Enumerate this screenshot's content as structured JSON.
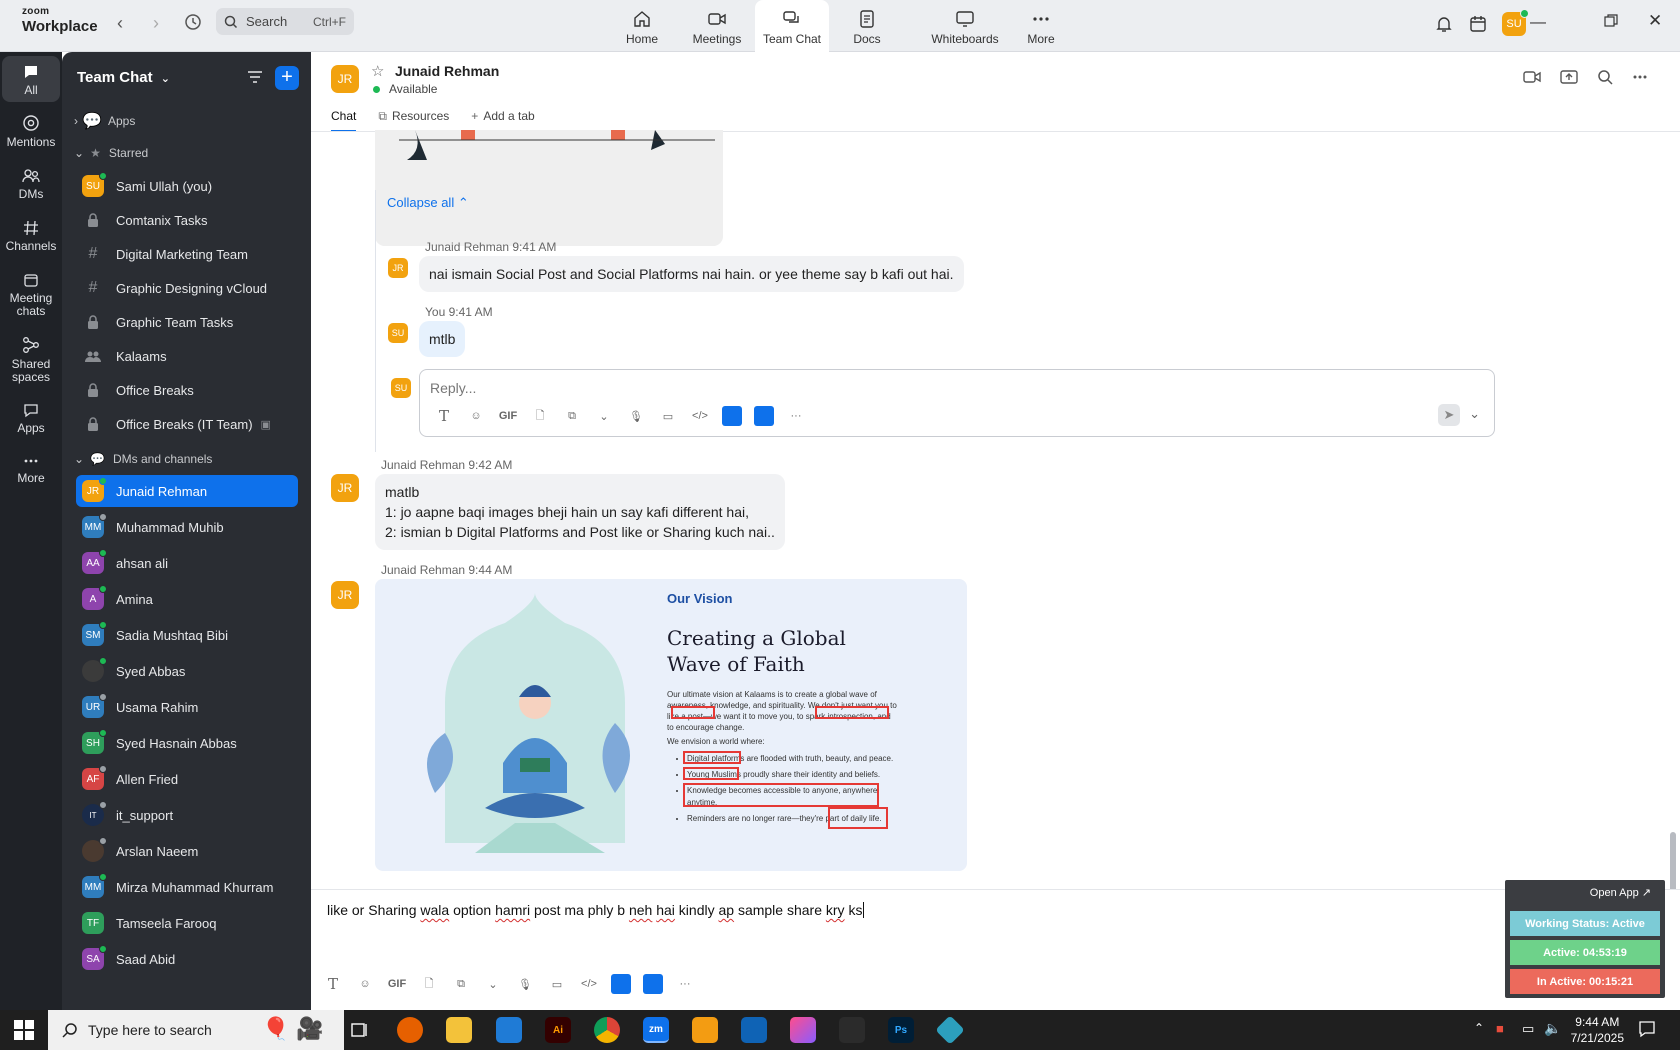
{
  "brand": {
    "line1": "zoom",
    "line2": "Workplace"
  },
  "search": {
    "label": "Search",
    "shortcut": "Ctrl+F"
  },
  "nav_tabs": [
    {
      "label": "Home"
    },
    {
      "label": "Meetings"
    },
    {
      "label": "Team Chat"
    },
    {
      "label": "Docs"
    },
    {
      "label": "Whiteboards"
    },
    {
      "label": "More"
    }
  ],
  "user": {
    "initials": "SU"
  },
  "rail": [
    {
      "label": "All"
    },
    {
      "label": "Mentions"
    },
    {
      "label": "DMs"
    },
    {
      "label": "Channels"
    },
    {
      "label": "Meeting chats"
    },
    {
      "label": "Shared spaces"
    },
    {
      "label": "Apps"
    },
    {
      "label": "More"
    }
  ],
  "sidebar": {
    "title": "Team Chat",
    "sections": {
      "apps": "Apps",
      "starred": "Starred",
      "dms": "DMs and channels"
    },
    "starred": [
      {
        "label": "Sami Ullah (you)",
        "initials": "SU"
      },
      {
        "label": "Comtanix Tasks"
      },
      {
        "label": "Digital Marketing Team"
      },
      {
        "label": "Graphic Designing vCloud"
      },
      {
        "label": "Graphic Team Tasks"
      },
      {
        "label": "Kalaams"
      },
      {
        "label": "Office Breaks"
      },
      {
        "label": "Office Breaks (IT Team)"
      }
    ],
    "dms": [
      {
        "label": "Junaid Rehman",
        "initials": "JR"
      },
      {
        "label": "Muhammad Muhib",
        "initials": "MM"
      },
      {
        "label": "ahsan ali",
        "initials": "AA"
      },
      {
        "label": "Amina",
        "initials": "A"
      },
      {
        "label": "Sadia Mushtaq Bibi",
        "initials": "SM"
      },
      {
        "label": "Syed Abbas",
        "initials": ""
      },
      {
        "label": "Usama Rahim",
        "initials": "UR"
      },
      {
        "label": "Syed Hasnain Abbas",
        "initials": "SH"
      },
      {
        "label": "Allen Fried",
        "initials": "AF"
      },
      {
        "label": "it_support",
        "initials": "IT"
      },
      {
        "label": "Arslan Naeem",
        "initials": ""
      },
      {
        "label": "Mirza Muhammad Khurram",
        "initials": "MM"
      },
      {
        "label": "Tamseela Farooq",
        "initials": "TF"
      },
      {
        "label": "Saad Abid",
        "initials": "SA"
      }
    ]
  },
  "channel": {
    "initials": "JR",
    "name": "Junaid Rehman",
    "status": "Available",
    "tabs": [
      "Chat",
      "Resources",
      "Add a tab"
    ]
  },
  "thread": {
    "collapse": "Collapse all",
    "m1_meta": "Junaid Rehman 9:41 AM",
    "m1_text": "nai ismain Social Post and Social Platforms nai hain. or yee theme say b kafi out hai.",
    "m2_meta": "You 9:41 AM",
    "m2_text": "mtlb",
    "reply_placeholder": "Reply..."
  },
  "messages": {
    "m3_meta": "Junaid Rehman 9:42 AM",
    "m3_lines": [
      "matlb",
      "1: jo aapne baqi images bheji hain un say kafi different hai,",
      "2: ismian b Digital Platforms and Post like or Sharing kuch nai.."
    ],
    "m4_meta": "Junaid Rehman 9:44 AM"
  },
  "image": {
    "kicker": "Our Vision",
    "title1": "Creating a Global",
    "title2": "Wave of Faith",
    "para1": "Our ultimate vision at Kalaams is to create a global wave of awareness, knowledge, and spirituality. We don't just want you to like a post—we want it to move you, to spark introspection, and to encourage change.",
    "para2": "We envision a world where:",
    "bullets": [
      "Digital platforms are flooded with truth, beauty, and peace.",
      "Young Muslims proudly share their identity and beliefs.",
      "Knowledge becomes accessible to anyone, anywhere, anytime.",
      "Reminders are no longer rare—they're part of daily life."
    ]
  },
  "composer": {
    "w1": "like or Sharing ",
    "w2": "wala",
    "w3": " option ",
    "w4": "hamri",
    "w5": " post ma phly b ",
    "w6": "neh",
    "w7": " ",
    "w8": "hai",
    "w9": " kindly ",
    "w10": "ap",
    "w11": " sample share ",
    "w12": "kry",
    "w13": " ks"
  },
  "tool_gif": "GIF",
  "widget": {
    "open": "Open App",
    "status": "Working Status: Active",
    "active": "Active: 04:53:19",
    "inactive": "In Active: 00:15:21",
    "colors": {
      "status": "#7ccbd6",
      "active": "#6ed28a",
      "inactive": "#ec6a5c"
    }
  },
  "taskbar": {
    "search": "Type here to search",
    "time": "9:44 AM",
    "date": "7/21/2025",
    "zoom": "zm",
    "ai": "Ai",
    "ps": "Ps"
  },
  "colors": {
    "accent": "#0e71eb",
    "avatar": "#f2a20f",
    "online": "#1db954"
  }
}
